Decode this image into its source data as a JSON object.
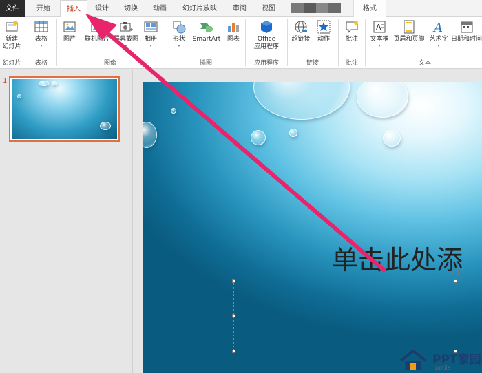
{
  "tabs": [
    {
      "label": "文件"
    },
    {
      "label": "开始"
    },
    {
      "label": "插入"
    },
    {
      "label": "设计"
    },
    {
      "label": "切换"
    },
    {
      "label": "动画"
    },
    {
      "label": "幻灯片放映"
    },
    {
      "label": "审阅"
    },
    {
      "label": "视图"
    },
    {
      "label": "格式"
    }
  ],
  "ribbon": {
    "buttons": [
      {
        "label": "新建",
        "label2": "幻灯片",
        "icon": "new-slide-icon"
      },
      {
        "label": "表格",
        "icon": "table-icon"
      },
      {
        "label": "图片",
        "icon": "picture-icon"
      },
      {
        "label": "联机图片",
        "icon": "online-picture-icon"
      },
      {
        "label": "屏幕截图",
        "icon": "screenshot-icon"
      },
      {
        "label": "相册",
        "icon": "album-icon"
      },
      {
        "label": "形状",
        "icon": "shapes-icon"
      },
      {
        "label": "SmartArt",
        "icon": "smartart-icon"
      },
      {
        "label": "图表",
        "icon": "chart-icon"
      },
      {
        "label": "Office",
        "label2": "应用程序",
        "icon": "office-apps-icon"
      },
      {
        "label": "超链接",
        "icon": "hyperlink-icon"
      },
      {
        "label": "动作",
        "icon": "action-icon"
      },
      {
        "label": "批注",
        "icon": "comment-icon"
      },
      {
        "label": "文本框",
        "icon": "textbox-icon"
      },
      {
        "label": "页眉和页脚",
        "icon": "header-footer-icon"
      },
      {
        "label": "艺术字",
        "icon": "wordart-icon"
      },
      {
        "label": "日期和时间",
        "icon": "datetime-icon"
      }
    ],
    "groups": [
      "幻灯片",
      "表格",
      "图像",
      "插图",
      "应用程序",
      "链接",
      "批注",
      "文本"
    ]
  },
  "thumbnail": {
    "number": "1"
  },
  "slide": {
    "title_placeholder": "单击此处添"
  },
  "watermark": {
    "text": "PPT家园",
    "sub": "pptjia"
  },
  "colors": {
    "accent": "#c43e1c",
    "arrow": "#e8246a"
  }
}
